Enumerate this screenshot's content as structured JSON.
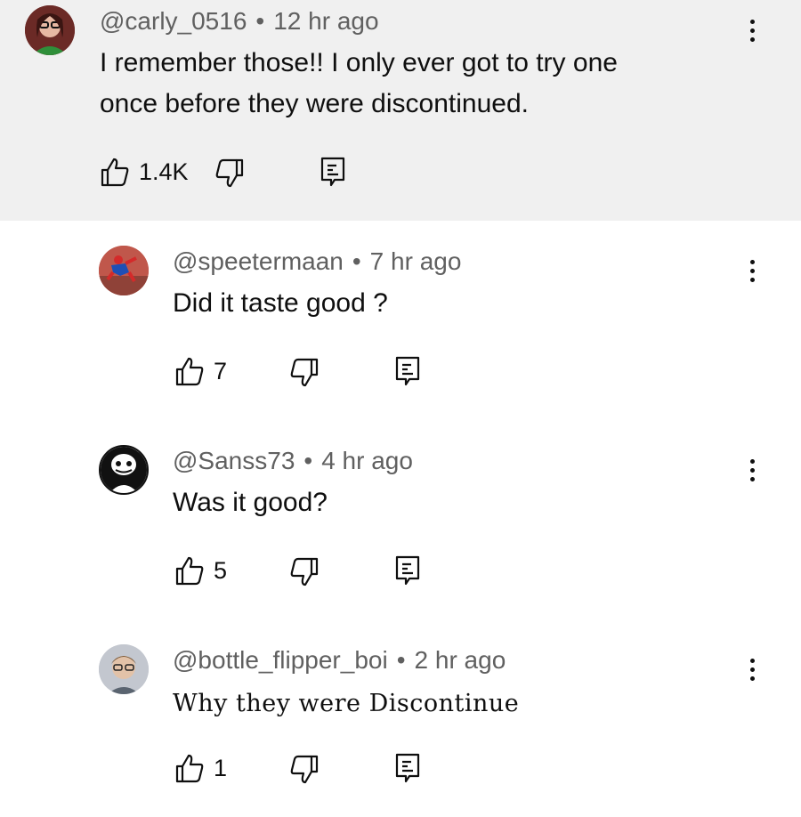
{
  "comments": [
    {
      "handle": "@carly_0516",
      "time": "12 hr ago",
      "text_line1": "I remember those!! I only ever got to try one",
      "text_line2": "once before they were discontinued.",
      "likes": "1.4K"
    },
    {
      "handle": "@speetermaan",
      "time": "7 hr ago",
      "text_line1": "Did it taste good ?",
      "likes": "7"
    },
    {
      "handle": "@Sanss73",
      "time": "4 hr ago",
      "text_line1": "Was it good?",
      "likes": "5"
    },
    {
      "handle": "@bottle_flipper_boi",
      "time": "2 hr ago",
      "text_line1": "Why they were Discontinue",
      "likes": "1"
    }
  ],
  "separator": "•",
  "icons": {
    "like": "thumbs-up-icon",
    "dislike": "thumbs-down-icon",
    "reply": "reply-comment-icon",
    "more": "more-vertical-icon"
  },
  "colors": {
    "highlight_bg": "#f0f0f0",
    "meta_text": "#606060",
    "text": "#0f0f0f"
  }
}
